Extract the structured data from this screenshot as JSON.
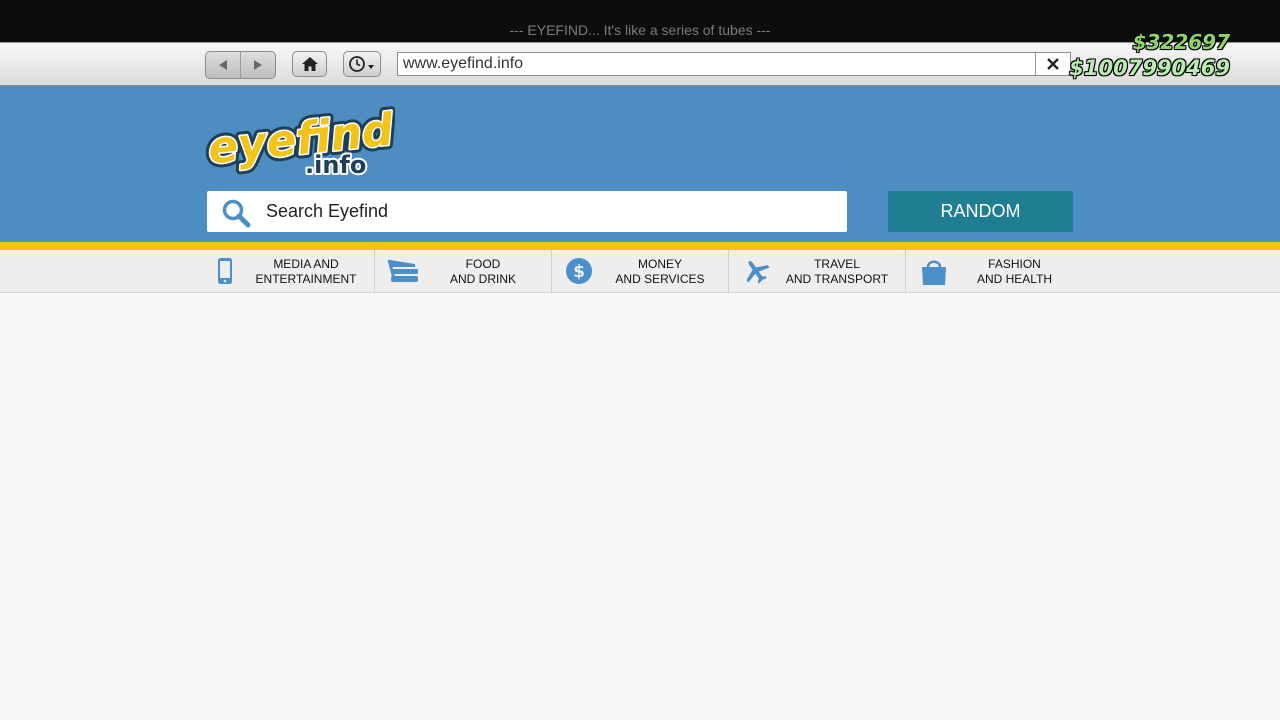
{
  "window": {
    "title": "--- EYEFIND... It's like a series of tubes ---"
  },
  "toolbar": {
    "url": "www.eyefind.info"
  },
  "hud": {
    "cash": "$322697",
    "bank": "$1007990469"
  },
  "header": {
    "logo": {
      "main": "eyefind",
      "sub": ".info"
    },
    "search": {
      "placeholder": "Search Eyefind"
    },
    "random_label": "RANDOM"
  },
  "categories": [
    {
      "label": "MEDIA AND\nENTERTAINMENT",
      "icon": "phone-icon"
    },
    {
      "label": "FOOD\nAND DRINK",
      "icon": "burger-icon"
    },
    {
      "label": "MONEY\nAND SERVICES",
      "icon": "dollar-icon"
    },
    {
      "label": "TRAVEL\nAND TRANSPORT",
      "icon": "airplane-icon"
    },
    {
      "label": "FASHION\nAND HEALTH",
      "icon": "shopping-bag-icon"
    }
  ],
  "colors": {
    "header_blue": "#4e8dc1",
    "accent_yellow": "#f2c318",
    "random_button": "#1f7e91",
    "icon_blue": "#4b90c8"
  }
}
